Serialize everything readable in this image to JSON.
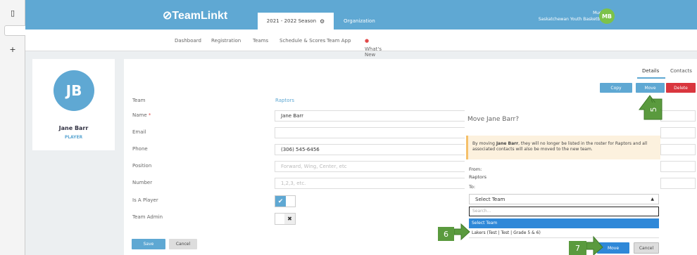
{
  "app": {
    "logo": "⊘TeamLinkt",
    "season": "2021 - 2022 Season",
    "organization": "Organization",
    "user_name": "Mugs",
    "user_org": "Saskatchewan Youth Basketb...",
    "user_initials": "MB"
  },
  "nav": {
    "items": [
      "Dashboard",
      "Registration",
      "Teams",
      "Schedule & Scores",
      "Team App",
      "What's New"
    ]
  },
  "profile": {
    "initials": "JB",
    "name": "Jane Barr",
    "role": "PLAYER"
  },
  "tabs": [
    "Details",
    "Contacts"
  ],
  "actions": {
    "copy": "Copy",
    "move": "Move",
    "delete": "Delete"
  },
  "form": {
    "labels": {
      "team": "Team",
      "name": "Name",
      "email": "Email",
      "phone": "Phone",
      "position": "Position",
      "number": "Number",
      "is_player": "Is A Player",
      "team_admin": "Team Admin"
    },
    "required_mark": "*",
    "team_value": "Raptors",
    "name_value": "Jane Barr",
    "email_value": "",
    "phone_value": "(306) 545-6456",
    "position_placeholder": "Forward, Wing, Center, etc",
    "number_placeholder": "1,2,3, etc.",
    "is_player": true,
    "team_admin": false,
    "save": "Save",
    "cancel": "Cancel"
  },
  "modal": {
    "title": "Move Jane Barr?",
    "warning_prefix": "By moving ",
    "warning_name": "Jane Barr",
    "warning_rest": ", they will no longer be listed in the roster for Raptors and all associated contacts will also be moved to the new team.",
    "from_label": "From:",
    "from_value": "Raptors",
    "to_label": "To:",
    "select_value": "Select Team",
    "search_placeholder": "Search...",
    "options": [
      "Select Team",
      "Lakers (Test | Test | Grade 5 & 6)"
    ],
    "move": "Move",
    "cancel": "Cancel"
  },
  "callouts": [
    "5",
    "6",
    "7"
  ],
  "colors": {
    "primary": "#5fa8d3",
    "danger": "#d9363e",
    "callout": "#5a9a3e",
    "highlight": "#2f88d8"
  }
}
